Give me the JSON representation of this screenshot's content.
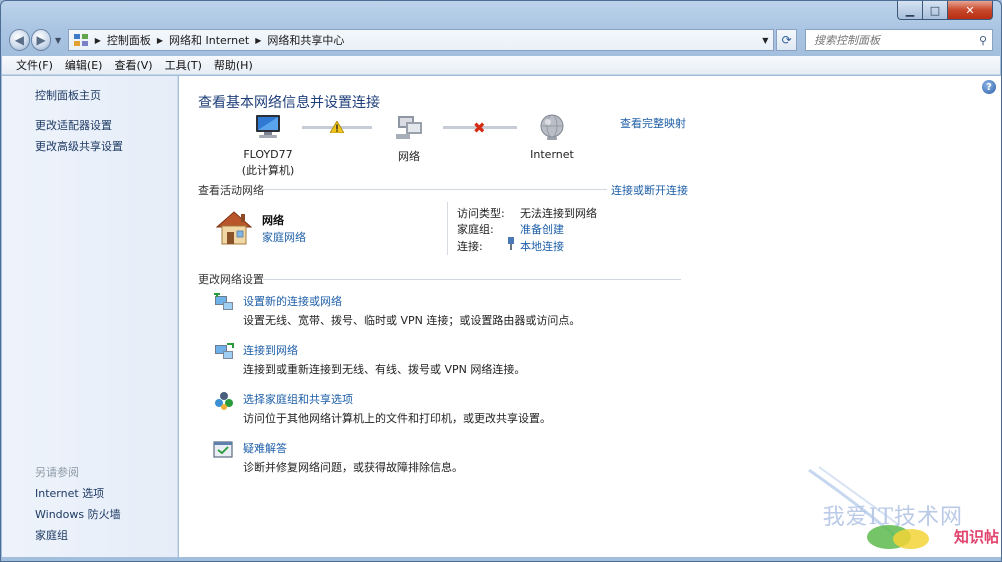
{
  "breadcrumb": [
    "控制面板",
    "网络和 Internet",
    "网络和共享中心"
  ],
  "search": {
    "placeholder": "搜索控制面板"
  },
  "menu": [
    "文件(F)",
    "编辑(E)",
    "查看(V)",
    "工具(T)",
    "帮助(H)"
  ],
  "sidebar": {
    "items": [
      "控制面板主页",
      "更改适配器设置",
      "更改高级共享设置"
    ],
    "see_also_label": "另请参阅",
    "see_also": [
      "Internet 选项",
      "Windows 防火墙",
      "家庭组"
    ]
  },
  "main": {
    "title": "查看基本网络信息并设置连接",
    "view_full_map": "查看完整映射",
    "map": {
      "computer_name": "FLOYD77",
      "computer_sub": "(此计算机)",
      "network": "网络",
      "internet": "Internet"
    },
    "active_networks": {
      "heading": "查看活动网络",
      "connect_link": "连接或断开连接",
      "name": "网络",
      "type": "家庭网络",
      "access_label": "访问类型:",
      "access_value": "无法连接到网络",
      "homegroup_label": "家庭组:",
      "homegroup_value": "准备创建",
      "connection_label": "连接:",
      "connection_value": "本地连接"
    },
    "change_settings": {
      "heading": "更改网络设置",
      "tasks": [
        {
          "link": "设置新的连接或网络",
          "desc": "设置无线、宽带、拨号、临时或 VPN 连接；或设置路由器或访问点。",
          "icon": "new-connection-icon"
        },
        {
          "link": "连接到网络",
          "desc": "连接到或重新连接到无线、有线、拨号或 VPN 网络连接。",
          "icon": "connect-network-icon"
        },
        {
          "link": "选择家庭组和共享选项",
          "desc": "访问位于其他网络计算机上的文件和打印机，或更改共享设置。",
          "icon": "homegroup-icon"
        },
        {
          "link": "疑难解答",
          "desc": "诊断并修复网络问题，或获得故障排除信息。",
          "icon": "troubleshoot-icon"
        }
      ]
    }
  },
  "watermark": {
    "text": "我爱IT技术网",
    "text2": "知识帖"
  },
  "colors": {
    "link": "#1e5fa8",
    "title": "#1e3f7a",
    "sidebar_bg": "#eef3fb",
    "chrome": "#a9c4e2"
  }
}
